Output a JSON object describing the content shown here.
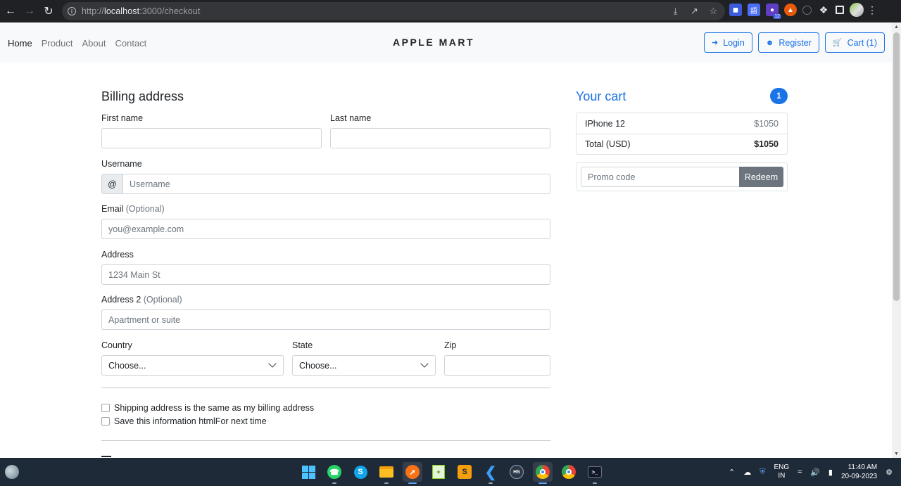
{
  "browser": {
    "url_scheme": "http://",
    "url_host": "localhost",
    "url_path": ":3000/checkout",
    "extension_badge": "12"
  },
  "navbar": {
    "links": [
      "Home",
      "Product",
      "About",
      "Contact"
    ],
    "brand": "APPLE MART",
    "login": "Login",
    "register": "Register",
    "cart": "Cart (1)"
  },
  "billing": {
    "title": "Billing address",
    "first_name_label": "First name",
    "last_name_label": "Last name",
    "username_label": "Username",
    "username_prefix": "@",
    "username_placeholder": "Username",
    "email_label": "Email",
    "email_optional": "(Optional)",
    "email_placeholder": "you@example.com",
    "address_label": "Address",
    "address_placeholder": "1234 Main St",
    "address2_label": "Address 2",
    "address2_optional": "(Optional)",
    "address2_placeholder": "Apartment or suite",
    "country_label": "Country",
    "country_value": "Choose...",
    "state_label": "State",
    "state_value": "Choose...",
    "zip_label": "Zip",
    "same_address": "Shipping address is the same as my billing address",
    "save_info": "Save this information htmlFor next time"
  },
  "cart": {
    "title": "Your cart",
    "count": "1",
    "items": [
      {
        "name": "IPhone 12",
        "price": "$1050"
      }
    ],
    "total_label": "Total (USD)",
    "total_value": "$1050",
    "promo_placeholder": "Promo code",
    "redeem_label": "Redeem"
  },
  "taskbar": {
    "apps": [
      "windows-start",
      "whatsapp",
      "skype",
      "file-explorer",
      "postman",
      "notepad-plus",
      "sublime-text",
      "vscode",
      "hs-app",
      "chrome",
      "chrome-alt",
      "terminal"
    ],
    "lang_line1": "ENG",
    "lang_line2": "IN",
    "time": "11:40 AM",
    "date": "20-09-2023"
  },
  "colors": {
    "primary": "#1a73e8",
    "secondary_button": "#6c757d",
    "navbar_bg": "#f8f9fa",
    "taskbar_bg": "#1f2a38"
  }
}
